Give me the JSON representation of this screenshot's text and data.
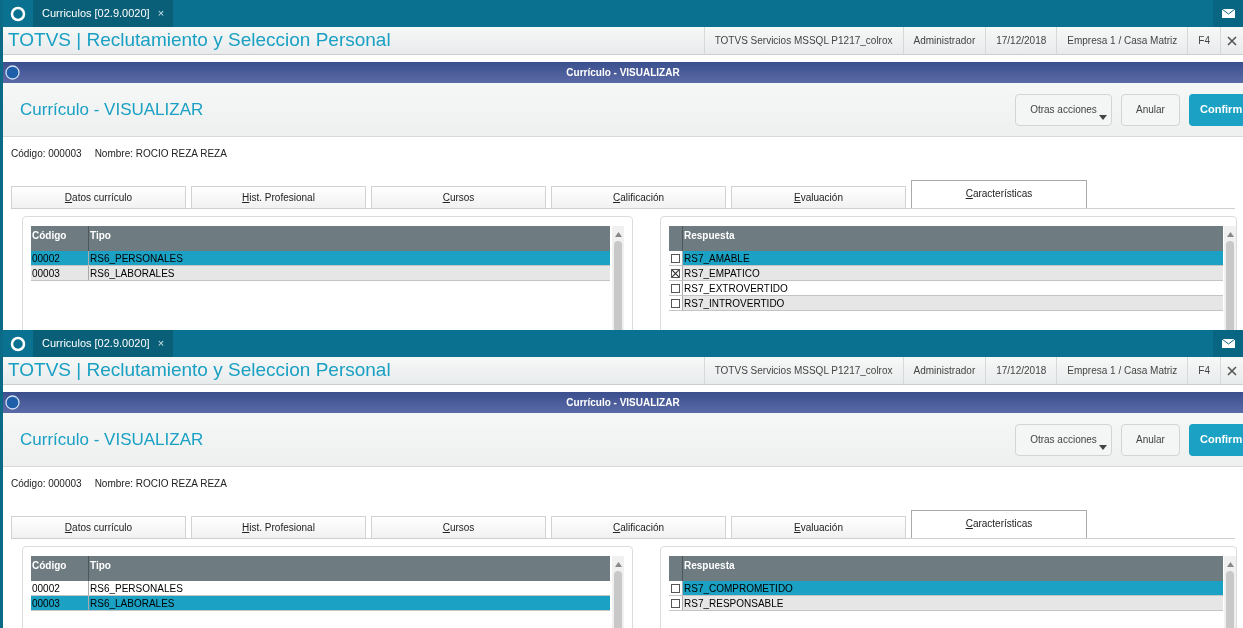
{
  "screens": [
    {
      "top_bar": {
        "tab_label": "Curriculos [02.9.0020]",
        "tab_close": "×"
      },
      "header": {
        "title": "TOTVS | Reclutamiento y Seleccion Personal",
        "status_items": [
          "TOTVS Servicios MSSQL P1217_colrox",
          "Administrador",
          "17/12/2018",
          "Empresa 1 / Casa Matriz",
          "F4"
        ]
      },
      "dialog": {
        "title_bar": "Currículo - VISUALIZAR",
        "heading": "Currículo - VISUALIZAR",
        "buttons": [
          {
            "label": "Otras acciones",
            "kind": "menu"
          },
          {
            "label": "Anular",
            "kind": "plain"
          },
          {
            "label": "Confirm",
            "kind": "primary"
          }
        ]
      },
      "record": {
        "codigo": "Código: 000003",
        "nombre": "Nombre: ROCIO REZA REZA"
      },
      "tabs": [
        {
          "label": "Datos currículo",
          "selected": false
        },
        {
          "label": "Hist. Profesional",
          "selected": false
        },
        {
          "label": "Cursos",
          "selected": false
        },
        {
          "label": "Calificación",
          "selected": false
        },
        {
          "label": "Evaluación",
          "selected": false
        },
        {
          "label": "Características",
          "selected": true
        }
      ],
      "left_grid": {
        "columns": [
          "Código",
          "Tipo"
        ],
        "rows": [
          {
            "cells": [
              "00002",
              "RS6_PERSONALES"
            ],
            "selected": true
          },
          {
            "cells": [
              "00003",
              "RS6_LABORALES"
            ],
            "selected": false
          }
        ]
      },
      "right_grid": {
        "columns": [
          "Respuesta"
        ],
        "rows": [
          {
            "label": "RS7_AMABLE",
            "checked": false,
            "selected": true
          },
          {
            "label": "RS7_EMPATICO",
            "checked": true,
            "selected": false
          },
          {
            "label": "RS7_EXTROVERTIDO",
            "checked": false,
            "selected": false
          },
          {
            "label": "RS7_INTROVERTIDO",
            "checked": false,
            "selected": false
          }
        ]
      }
    },
    {
      "top_bar": {
        "tab_label": "Curriculos [02.9.0020]",
        "tab_close": "×"
      },
      "header": {
        "title": "TOTVS | Reclutamiento y Seleccion Personal",
        "status_items": [
          "TOTVS Servicios MSSQL P1217_colrox",
          "Administrador",
          "17/12/2018",
          "Empresa 1 / Casa Matriz",
          "F4"
        ]
      },
      "dialog": {
        "title_bar": "Currículo - VISUALIZAR",
        "heading": "Currículo - VISUALIZAR",
        "buttons": [
          {
            "label": "Otras acciones",
            "kind": "menu"
          },
          {
            "label": "Anular",
            "kind": "plain"
          },
          {
            "label": "Confirm",
            "kind": "primary"
          }
        ]
      },
      "record": {
        "codigo": "Código: 000003",
        "nombre": "Nombre: ROCIO REZA REZA"
      },
      "tabs": [
        {
          "label": "Datos currículo",
          "selected": false
        },
        {
          "label": "Hist. Profesional",
          "selected": false
        },
        {
          "label": "Cursos",
          "selected": false
        },
        {
          "label": "Calificación",
          "selected": false
        },
        {
          "label": "Evaluación",
          "selected": false
        },
        {
          "label": "Características",
          "selected": true
        }
      ],
      "left_grid": {
        "columns": [
          "Código",
          "Tipo"
        ],
        "rows": [
          {
            "cells": [
              "00002",
              "RS6_PERSONALES"
            ],
            "selected": false
          },
          {
            "cells": [
              "00003",
              "RS6_LABORALES"
            ],
            "selected": true
          }
        ]
      },
      "right_grid": {
        "columns": [
          "Respuesta"
        ],
        "rows": [
          {
            "label": "RS7_COMPROMETIDO",
            "checked": false,
            "selected": true
          },
          {
            "label": "RS7_RESPONSABLE",
            "checked": false,
            "selected": false
          }
        ]
      }
    }
  ]
}
